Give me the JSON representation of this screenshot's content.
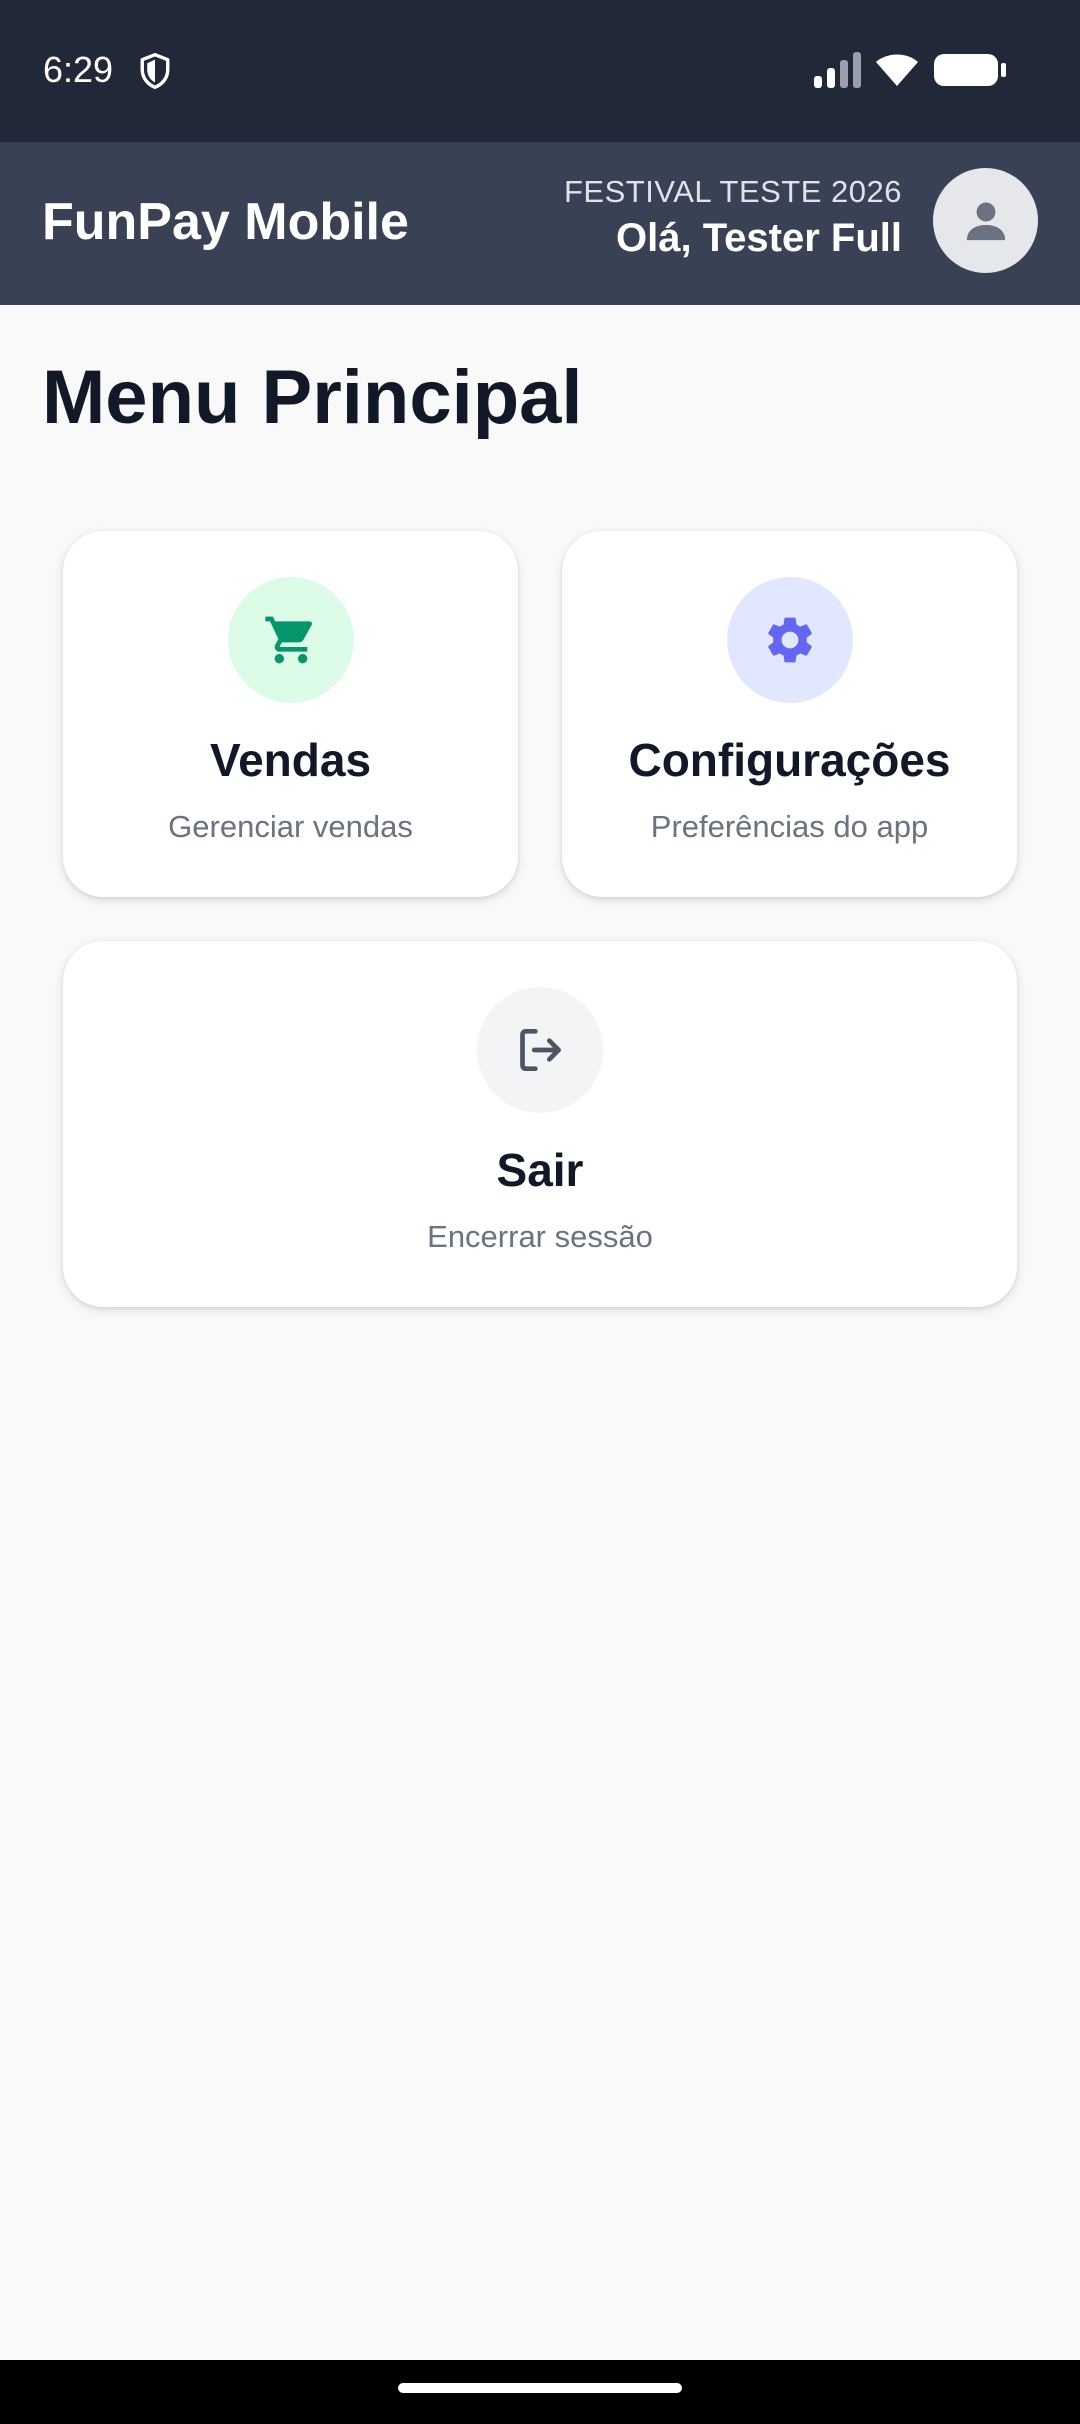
{
  "status_bar": {
    "time": "6:29",
    "icons": [
      "shield-icon",
      "signal-icon",
      "wifi-icon",
      "battery-icon"
    ]
  },
  "header": {
    "app_title": "FunPay Mobile",
    "event_name": "FESTIVAL TESTE 2026",
    "greeting": "Olá, Tester Full",
    "avatar_icon": "person-icon"
  },
  "main": {
    "title": "Menu Principal",
    "cards": [
      {
        "title": "Vendas",
        "subtitle": "Gerenciar vendas",
        "icon": "cart-icon",
        "icon_color": "#059669",
        "circle_color": "#dcfce7"
      },
      {
        "title": "Configurações",
        "subtitle": "Preferências do app",
        "icon": "gear-icon",
        "icon_color": "#6366f1",
        "circle_color": "#e0e7ff"
      },
      {
        "title": "Sair",
        "subtitle": "Encerrar sessão",
        "icon": "logout-icon",
        "icon_color": "#4b5563",
        "circle_color": "#f3f4f6"
      }
    ]
  },
  "colors": {
    "status_bar_bg": "#212838",
    "header_bg": "#384254",
    "page_bg": "#f9f9f9",
    "title_text": "#111827",
    "subtitle_text": "#6b7280"
  }
}
